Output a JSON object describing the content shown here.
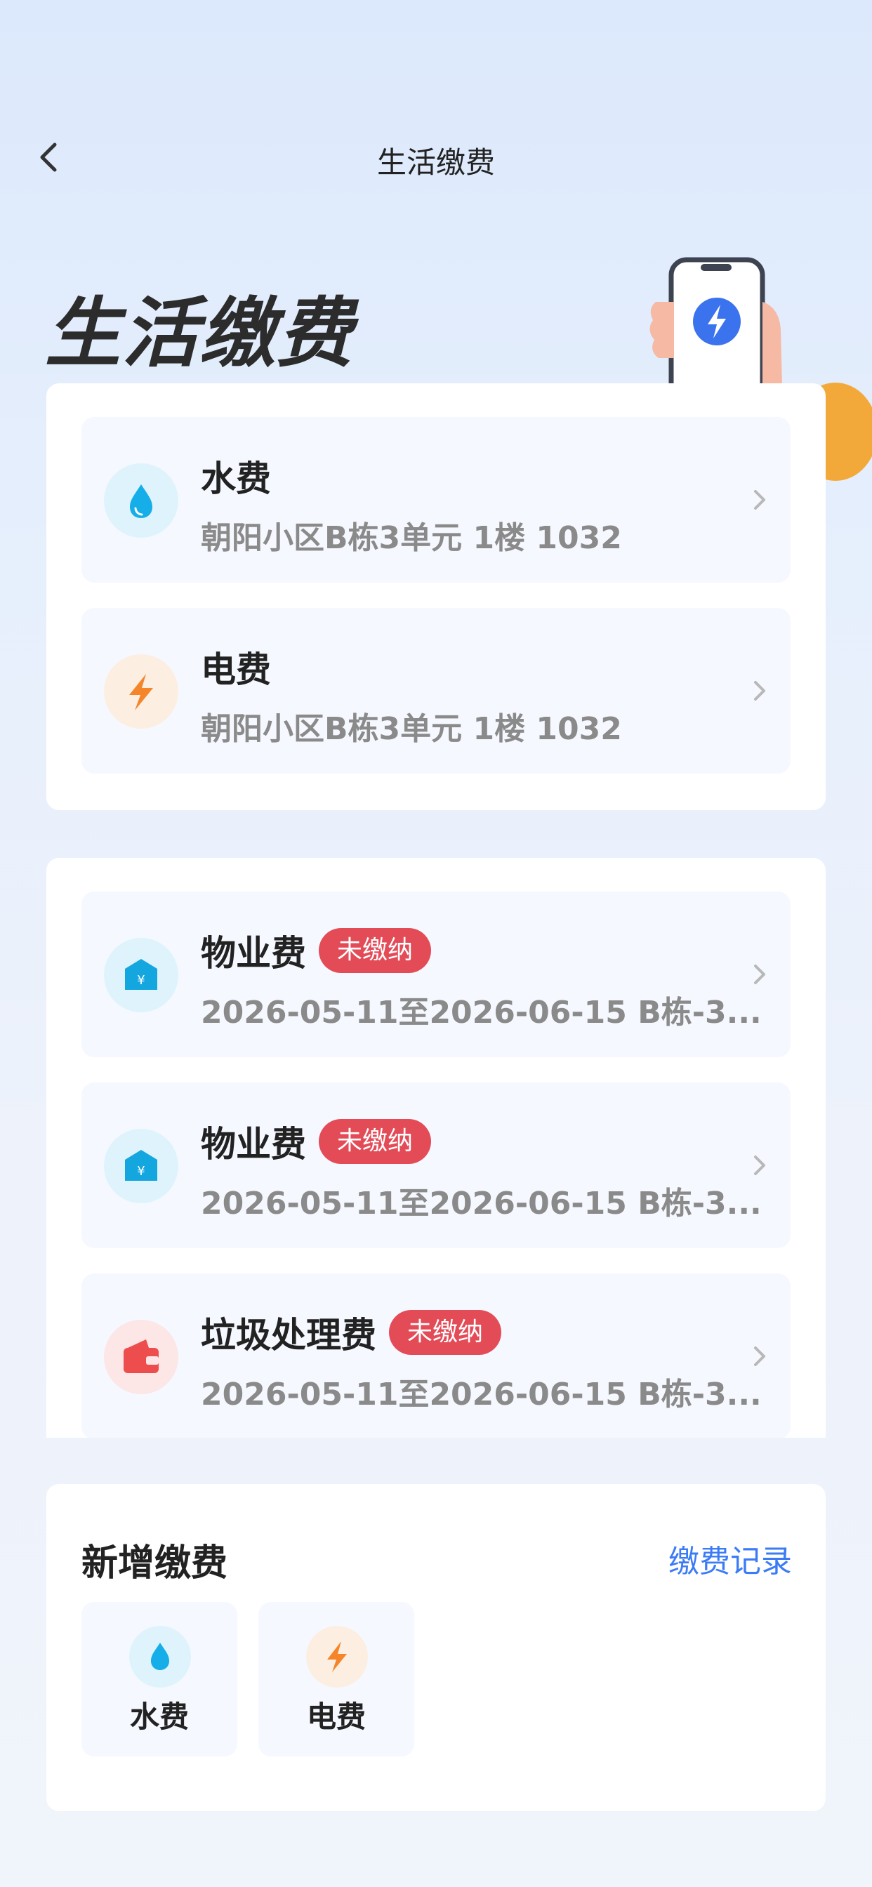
{
  "nav": {
    "title": "生活缴费"
  },
  "hero": {
    "title": "生活缴费"
  },
  "utilities": [
    {
      "name": "水费",
      "address": "朝阳小区B栋3单元 1楼 1032",
      "icon": "water-drop-icon",
      "color": "#15aee8"
    },
    {
      "name": "电费",
      "address": "朝阳小区B栋3单元 1楼 1032",
      "icon": "lightning-icon",
      "color": "#f5852a"
    }
  ],
  "bills": [
    {
      "name": "物业费",
      "status": "未缴纳",
      "detail": "2026-05-11至2026-06-15 B栋-3...",
      "icon": "property-house-icon"
    },
    {
      "name": "物业费",
      "status": "未缴纳",
      "detail": "2026-05-11至2026-06-15 B栋-3...",
      "icon": "property-house-icon"
    },
    {
      "name": "垃圾处理费",
      "status": "未缴纳",
      "detail": "2026-05-11至2026-06-15 B栋-3...",
      "icon": "wallet-icon"
    }
  ],
  "new_payment": {
    "title": "新增缴费",
    "record_link": "缴费记录",
    "items": [
      {
        "label": "水费",
        "icon": "water-drop-icon"
      },
      {
        "label": "电费",
        "icon": "lightning-icon"
      }
    ]
  },
  "colors": {
    "accent": "#3b7cf6",
    "badge": "#e34b57",
    "water": "#15aee8",
    "power": "#f5852a",
    "trash": "#ee4d4d"
  }
}
